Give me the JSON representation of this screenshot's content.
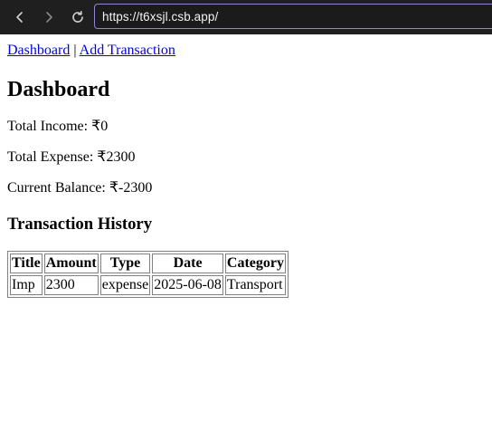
{
  "browser": {
    "url": "https://t6xsjl.csb.app/"
  },
  "nav": {
    "dashboard_link": "Dashboard",
    "separator": "|",
    "add_transaction_link": "Add Transaction"
  },
  "page_title": "Dashboard",
  "stats": {
    "income_label": "Total Income: ",
    "income_value": "₹0",
    "expense_label": "Total Expense: ",
    "expense_value": "₹2300",
    "balance_label": "Current Balance: ",
    "balance_value": "₹-2300"
  },
  "history": {
    "heading": "Transaction History",
    "columns": [
      "Title",
      "Amount",
      "Type",
      "Date",
      "Category"
    ],
    "rows": [
      [
        "Imp",
        "2300",
        "expense",
        "2025-06-08",
        "Transport"
      ]
    ]
  }
}
